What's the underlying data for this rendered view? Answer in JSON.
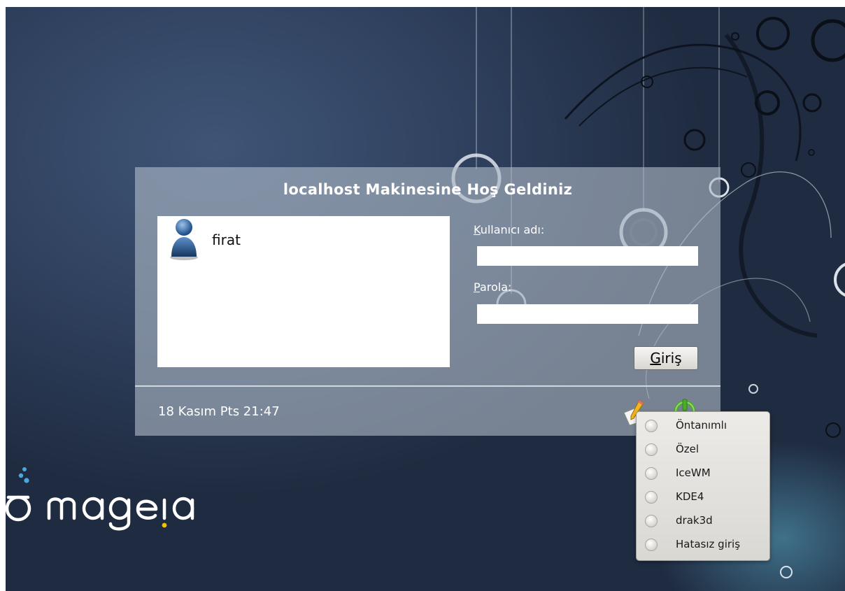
{
  "login": {
    "greeting": "localhost Makinesine Hoş Geldiniz",
    "users": [
      {
        "name": "firat"
      }
    ],
    "username_label_accel": "K",
    "username_label_rest": "ullanıcı adı:",
    "username_value": "",
    "password_label_accel": "P",
    "password_label_rest": "arola:",
    "password_value": "",
    "login_button_accel": "G",
    "login_button_rest": "iriş",
    "clock": "18 Kasım Pts 21:47"
  },
  "session_menu": {
    "items": [
      {
        "label": "Öntanımlı"
      },
      {
        "label": "Özel"
      },
      {
        "label": "IceWM"
      },
      {
        "label": "KDE4"
      },
      {
        "label": "drak3d"
      },
      {
        "label": "Hatasız giriş"
      }
    ]
  },
  "icons": {
    "user": "user-avatar-icon",
    "session": "pencil-notepad-icon",
    "power": "power-icon"
  },
  "colors": {
    "background": "#2e3f5c",
    "panel": "#aeb8c5",
    "logo": "#ffffff",
    "logo_drop": "#4aa8e0"
  }
}
